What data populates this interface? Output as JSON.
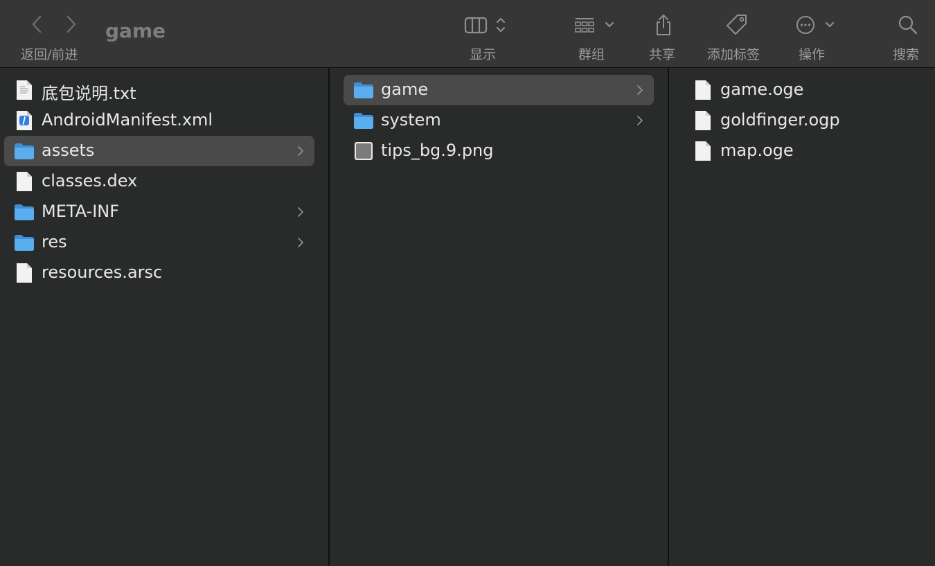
{
  "window": {
    "title": "game"
  },
  "toolbar": {
    "nav_label": "返回/前进",
    "view_label": "显示",
    "group_label": "群组",
    "share_label": "共享",
    "tag_label": "添加标签",
    "action_label": "操作",
    "search_label": "搜索"
  },
  "columns": [
    {
      "items": [
        {
          "name": "底包说明.txt",
          "icon": "text-file-icon",
          "folder": false,
          "selected": false
        },
        {
          "name": "AndroidManifest.xml",
          "icon": "xml-file-icon",
          "folder": false,
          "selected": false
        },
        {
          "name": "assets",
          "icon": "folder-icon",
          "folder": true,
          "selected": true
        },
        {
          "name": "classes.dex",
          "icon": "document-icon",
          "folder": false,
          "selected": false
        },
        {
          "name": "META-INF",
          "icon": "folder-icon",
          "folder": true,
          "selected": false
        },
        {
          "name": "res",
          "icon": "folder-icon",
          "folder": true,
          "selected": false
        },
        {
          "name": "resources.arsc",
          "icon": "document-icon",
          "folder": false,
          "selected": false
        }
      ]
    },
    {
      "items": [
        {
          "name": "game",
          "icon": "folder-icon",
          "folder": true,
          "selected": true
        },
        {
          "name": "system",
          "icon": "folder-icon",
          "folder": true,
          "selected": false
        },
        {
          "name": "tips_bg.9.png",
          "icon": "image-file-icon",
          "folder": false,
          "selected": false
        }
      ]
    },
    {
      "items": [
        {
          "name": "game.oge",
          "icon": "document-icon",
          "folder": false,
          "selected": false
        },
        {
          "name": "goldfinger.ogp",
          "icon": "document-icon",
          "folder": false,
          "selected": false
        },
        {
          "name": "map.oge",
          "icon": "document-icon",
          "folder": false,
          "selected": false
        }
      ]
    }
  ],
  "colors": {
    "background": "#292a2a",
    "toolbar": "#363636",
    "selection": "#4a4a4b",
    "folder": "#5aaef0"
  }
}
